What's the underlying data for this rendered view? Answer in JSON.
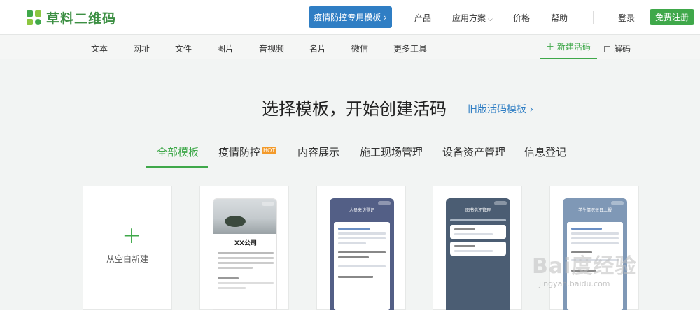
{
  "header": {
    "logo_text": "草料二维码",
    "promo_button": "疫情防控专用模板 ›",
    "nav": {
      "product": "产品",
      "solutions": "应用方案",
      "pricing": "价格",
      "help": "帮助"
    },
    "login": "登录",
    "register": "免费注册"
  },
  "subnav": {
    "items": [
      "文本",
      "网址",
      "文件",
      "图片",
      "音视频",
      "名片",
      "微信",
      "更多工具"
    ],
    "new_code": "＋ 新建活码",
    "decode": "解码"
  },
  "headline": {
    "title": "选择模板，开始创建活码",
    "old_link": "旧版活码模板 ›"
  },
  "tabs": {
    "all": "全部模板",
    "epidemic": "疫情防控",
    "hot_badge": "HOT",
    "content": "内容展示",
    "construction": "施工现场管理",
    "assets": "设备资产管理",
    "registration": "信息登记"
  },
  "cards": {
    "blank_label": "从空白新建",
    "company_title": "XX公司",
    "visitor_title": "人员来访登记",
    "library_title": "图书借还管理",
    "student_title": "学生情况每日上报"
  },
  "watermark": {
    "main": "Bai度经验",
    "sub": "jingyan.baidu.com"
  },
  "colors": {
    "brand_green": "#3fa84a",
    "promo_blue": "#2f7ec4",
    "hot_orange": "#f39a2a"
  }
}
